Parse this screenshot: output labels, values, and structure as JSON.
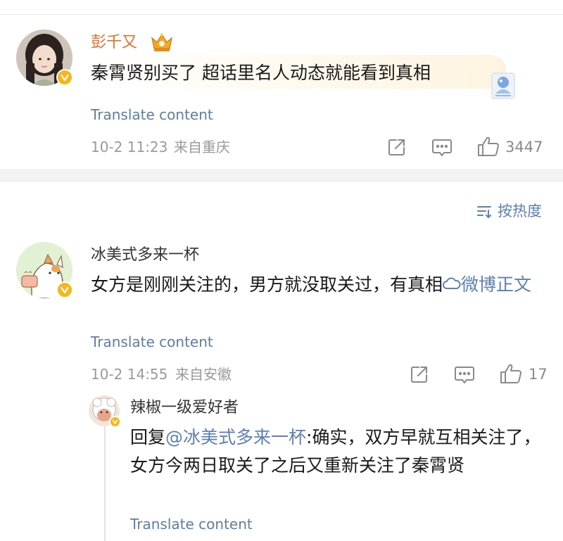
{
  "comment1": {
    "username": "彭千又",
    "text": "秦霄贤别买了 超话里名人动态就能看到真相",
    "translate_label": "Translate content",
    "time": "10-2 11:23",
    "location": "来自重庆",
    "like_count": "3447"
  },
  "sort": {
    "label": "按热度"
  },
  "comment2": {
    "username": "冰美式多来一杯",
    "text": "女方是刚刚关注的，男方就没取关过，有真相",
    "link_text": "微博正文",
    "translate_label": "Translate content",
    "time": "10-2 14:55",
    "location": "来自安徽",
    "like_count": "17"
  },
  "reply": {
    "username": "辣椒一级爱好者",
    "reply_prefix": "回复",
    "mention": "@冰美式多来一杯",
    "text": ":确实，双方早就互相关注了，女方今两日取关了之后又重新关注了秦霄贤",
    "translate_label": "Translate content"
  },
  "colors": {
    "username_vip": "#e8702a",
    "username_normal": "#333333",
    "link": "#5b81b8",
    "translate": "#5c7fa6",
    "verified_badge": "#f8b51a"
  },
  "icons": [
    "share-icon",
    "comment-icon",
    "like-icon",
    "sort-icon",
    "crown-badge-icon",
    "verified-icon",
    "sticker-icon",
    "link-icon"
  ]
}
